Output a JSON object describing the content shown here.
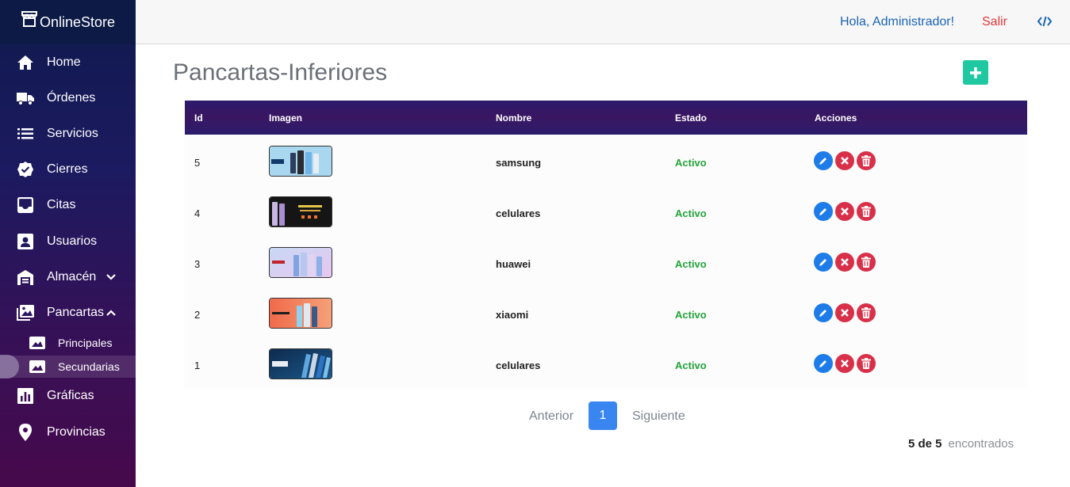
{
  "brand": {
    "name": "OnlineStore"
  },
  "sidebar": {
    "items": [
      {
        "label": "Home",
        "icon": "home-icon"
      },
      {
        "label": "Órdenes",
        "icon": "truck-icon"
      },
      {
        "label": "Servicios",
        "icon": "list-icon"
      },
      {
        "label": "Cierres",
        "icon": "badge-check-icon"
      },
      {
        "label": "Citas",
        "icon": "inbox-icon"
      },
      {
        "label": "Usuarios",
        "icon": "user-card-icon"
      },
      {
        "label": "Almacén",
        "icon": "warehouse-icon"
      },
      {
        "label": "Pancartas",
        "icon": "images-icon"
      },
      {
        "label": "Gráficas",
        "icon": "bar-chart-icon"
      },
      {
        "label": "Provincias",
        "icon": "map-pin-icon"
      }
    ],
    "subitems": [
      {
        "label": "Principales",
        "icon": "image-icon"
      },
      {
        "label": "Secundarias",
        "icon": "image-icon"
      }
    ]
  },
  "topbar": {
    "greeting": "Hola, Administrador!",
    "logout": "Salir"
  },
  "page": {
    "title": "Pancartas-Inferiores"
  },
  "table": {
    "headers": {
      "id": "Id",
      "image": "Imagen",
      "name": "Nombre",
      "state": "Estado",
      "actions": "Acciones"
    },
    "rows": [
      {
        "id": "5",
        "name": "samsung",
        "state": "Activo"
      },
      {
        "id": "4",
        "name": "celulares",
        "state": "Activo"
      },
      {
        "id": "3",
        "name": "huawei",
        "state": "Activo"
      },
      {
        "id": "2",
        "name": "xiaomi",
        "state": "Activo"
      },
      {
        "id": "1",
        "name": "celulares",
        "state": "Activo"
      }
    ]
  },
  "pagination": {
    "prev": "Anterior",
    "current": "1",
    "next": "Siguiente",
    "count": "5 de 5",
    "found": "encontrados"
  },
  "colors": {
    "accent_add": "#1fc8a0",
    "active_state": "#23a33a",
    "edit": "#1e7ce8",
    "danger": "#d9304a",
    "page_button": "#3a86f0"
  }
}
